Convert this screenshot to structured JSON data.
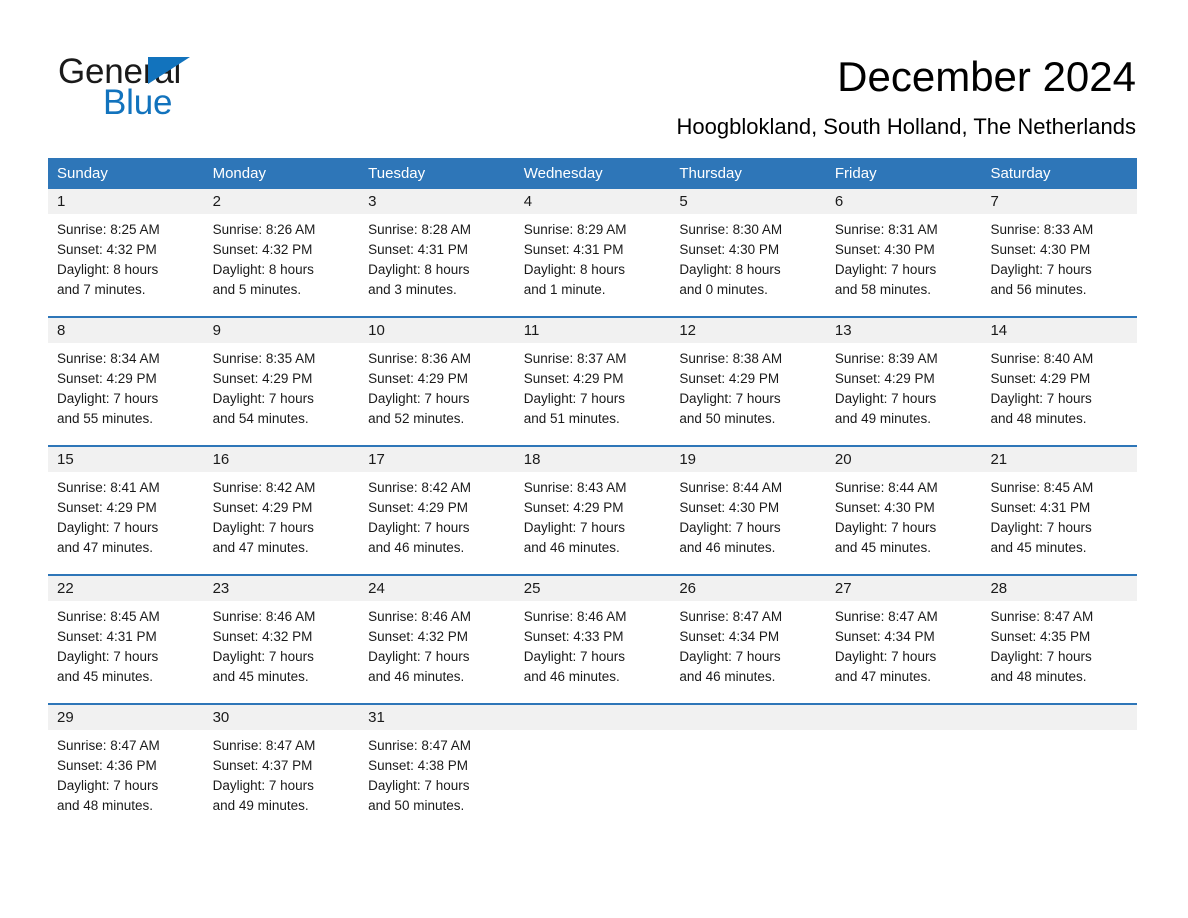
{
  "brand": {
    "name_part1": "General",
    "name_part2": "Blue",
    "triangle_color": "#1273bd",
    "text_color": "#1a1a1a"
  },
  "header": {
    "title": "December 2024",
    "subtitle": "Hoogblokland, South Holland, The Netherlands"
  },
  "theme": {
    "header_blue": "#2e76b8",
    "daynum_band": "#f1f1f1",
    "page_background": "#ffffff"
  },
  "weekdays": [
    "Sunday",
    "Monday",
    "Tuesday",
    "Wednesday",
    "Thursday",
    "Friday",
    "Saturday"
  ],
  "weeks": [
    {
      "days": [
        {
          "num": "1",
          "sunrise": "Sunrise: 8:25 AM",
          "sunset": "Sunset: 4:32 PM",
          "daylight1": "Daylight: 8 hours",
          "daylight2": "and 7 minutes."
        },
        {
          "num": "2",
          "sunrise": "Sunrise: 8:26 AM",
          "sunset": "Sunset: 4:32 PM",
          "daylight1": "Daylight: 8 hours",
          "daylight2": "and 5 minutes."
        },
        {
          "num": "3",
          "sunrise": "Sunrise: 8:28 AM",
          "sunset": "Sunset: 4:31 PM",
          "daylight1": "Daylight: 8 hours",
          "daylight2": "and 3 minutes."
        },
        {
          "num": "4",
          "sunrise": "Sunrise: 8:29 AM",
          "sunset": "Sunset: 4:31 PM",
          "daylight1": "Daylight: 8 hours",
          "daylight2": "and 1 minute."
        },
        {
          "num": "5",
          "sunrise": "Sunrise: 8:30 AM",
          "sunset": "Sunset: 4:30 PM",
          "daylight1": "Daylight: 8 hours",
          "daylight2": "and 0 minutes."
        },
        {
          "num": "6",
          "sunrise": "Sunrise: 8:31 AM",
          "sunset": "Sunset: 4:30 PM",
          "daylight1": "Daylight: 7 hours",
          "daylight2": "and 58 minutes."
        },
        {
          "num": "7",
          "sunrise": "Sunrise: 8:33 AM",
          "sunset": "Sunset: 4:30 PM",
          "daylight1": "Daylight: 7 hours",
          "daylight2": "and 56 minutes."
        }
      ]
    },
    {
      "days": [
        {
          "num": "8",
          "sunrise": "Sunrise: 8:34 AM",
          "sunset": "Sunset: 4:29 PM",
          "daylight1": "Daylight: 7 hours",
          "daylight2": "and 55 minutes."
        },
        {
          "num": "9",
          "sunrise": "Sunrise: 8:35 AM",
          "sunset": "Sunset: 4:29 PM",
          "daylight1": "Daylight: 7 hours",
          "daylight2": "and 54 minutes."
        },
        {
          "num": "10",
          "sunrise": "Sunrise: 8:36 AM",
          "sunset": "Sunset: 4:29 PM",
          "daylight1": "Daylight: 7 hours",
          "daylight2": "and 52 minutes."
        },
        {
          "num": "11",
          "sunrise": "Sunrise: 8:37 AM",
          "sunset": "Sunset: 4:29 PM",
          "daylight1": "Daylight: 7 hours",
          "daylight2": "and 51 minutes."
        },
        {
          "num": "12",
          "sunrise": "Sunrise: 8:38 AM",
          "sunset": "Sunset: 4:29 PM",
          "daylight1": "Daylight: 7 hours",
          "daylight2": "and 50 minutes."
        },
        {
          "num": "13",
          "sunrise": "Sunrise: 8:39 AM",
          "sunset": "Sunset: 4:29 PM",
          "daylight1": "Daylight: 7 hours",
          "daylight2": "and 49 minutes."
        },
        {
          "num": "14",
          "sunrise": "Sunrise: 8:40 AM",
          "sunset": "Sunset: 4:29 PM",
          "daylight1": "Daylight: 7 hours",
          "daylight2": "and 48 minutes."
        }
      ]
    },
    {
      "days": [
        {
          "num": "15",
          "sunrise": "Sunrise: 8:41 AM",
          "sunset": "Sunset: 4:29 PM",
          "daylight1": "Daylight: 7 hours",
          "daylight2": "and 47 minutes."
        },
        {
          "num": "16",
          "sunrise": "Sunrise: 8:42 AM",
          "sunset": "Sunset: 4:29 PM",
          "daylight1": "Daylight: 7 hours",
          "daylight2": "and 47 minutes."
        },
        {
          "num": "17",
          "sunrise": "Sunrise: 8:42 AM",
          "sunset": "Sunset: 4:29 PM",
          "daylight1": "Daylight: 7 hours",
          "daylight2": "and 46 minutes."
        },
        {
          "num": "18",
          "sunrise": "Sunrise: 8:43 AM",
          "sunset": "Sunset: 4:29 PM",
          "daylight1": "Daylight: 7 hours",
          "daylight2": "and 46 minutes."
        },
        {
          "num": "19",
          "sunrise": "Sunrise: 8:44 AM",
          "sunset": "Sunset: 4:30 PM",
          "daylight1": "Daylight: 7 hours",
          "daylight2": "and 46 minutes."
        },
        {
          "num": "20",
          "sunrise": "Sunrise: 8:44 AM",
          "sunset": "Sunset: 4:30 PM",
          "daylight1": "Daylight: 7 hours",
          "daylight2": "and 45 minutes."
        },
        {
          "num": "21",
          "sunrise": "Sunrise: 8:45 AM",
          "sunset": "Sunset: 4:31 PM",
          "daylight1": "Daylight: 7 hours",
          "daylight2": "and 45 minutes."
        }
      ]
    },
    {
      "days": [
        {
          "num": "22",
          "sunrise": "Sunrise: 8:45 AM",
          "sunset": "Sunset: 4:31 PM",
          "daylight1": "Daylight: 7 hours",
          "daylight2": "and 45 minutes."
        },
        {
          "num": "23",
          "sunrise": "Sunrise: 8:46 AM",
          "sunset": "Sunset: 4:32 PM",
          "daylight1": "Daylight: 7 hours",
          "daylight2": "and 45 minutes."
        },
        {
          "num": "24",
          "sunrise": "Sunrise: 8:46 AM",
          "sunset": "Sunset: 4:32 PM",
          "daylight1": "Daylight: 7 hours",
          "daylight2": "and 46 minutes."
        },
        {
          "num": "25",
          "sunrise": "Sunrise: 8:46 AM",
          "sunset": "Sunset: 4:33 PM",
          "daylight1": "Daylight: 7 hours",
          "daylight2": "and 46 minutes."
        },
        {
          "num": "26",
          "sunrise": "Sunrise: 8:47 AM",
          "sunset": "Sunset: 4:34 PM",
          "daylight1": "Daylight: 7 hours",
          "daylight2": "and 46 minutes."
        },
        {
          "num": "27",
          "sunrise": "Sunrise: 8:47 AM",
          "sunset": "Sunset: 4:34 PM",
          "daylight1": "Daylight: 7 hours",
          "daylight2": "and 47 minutes."
        },
        {
          "num": "28",
          "sunrise": "Sunrise: 8:47 AM",
          "sunset": "Sunset: 4:35 PM",
          "daylight1": "Daylight: 7 hours",
          "daylight2": "and 48 minutes."
        }
      ]
    },
    {
      "days": [
        {
          "num": "29",
          "sunrise": "Sunrise: 8:47 AM",
          "sunset": "Sunset: 4:36 PM",
          "daylight1": "Daylight: 7 hours",
          "daylight2": "and 48 minutes."
        },
        {
          "num": "30",
          "sunrise": "Sunrise: 8:47 AM",
          "sunset": "Sunset: 4:37 PM",
          "daylight1": "Daylight: 7 hours",
          "daylight2": "and 49 minutes."
        },
        {
          "num": "31",
          "sunrise": "Sunrise: 8:47 AM",
          "sunset": "Sunset: 4:38 PM",
          "daylight1": "Daylight: 7 hours",
          "daylight2": "and 50 minutes."
        },
        {
          "num": "",
          "sunrise": "",
          "sunset": "",
          "daylight1": "",
          "daylight2": ""
        },
        {
          "num": "",
          "sunrise": "",
          "sunset": "",
          "daylight1": "",
          "daylight2": ""
        },
        {
          "num": "",
          "sunrise": "",
          "sunset": "",
          "daylight1": "",
          "daylight2": ""
        },
        {
          "num": "",
          "sunrise": "",
          "sunset": "",
          "daylight1": "",
          "daylight2": ""
        }
      ]
    }
  ]
}
